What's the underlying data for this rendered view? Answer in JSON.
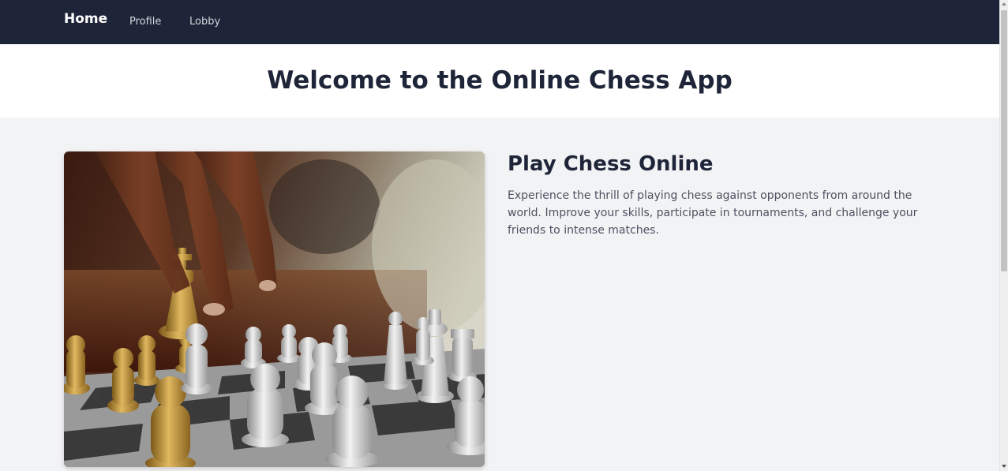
{
  "nav": {
    "home_label": "Home",
    "profile_label": "Profile",
    "lobby_label": "Lobby"
  },
  "header": {
    "title": "Welcome to the Online Chess App"
  },
  "hero": {
    "image": "chess-hand-moving-gold-piece-image"
  },
  "content": {
    "heading": "Play Chess Online",
    "body": "Experience the thrill of playing chess against opponents from around the world. Improve your skills, participate in tournaments, and challenge your friends to intense matches."
  },
  "colors": {
    "navbar": "#1f2538",
    "title_text": "#1f2538",
    "body_text": "#4b5160",
    "page_background": "#f2f3f5",
    "title_band": "#ffffff"
  }
}
